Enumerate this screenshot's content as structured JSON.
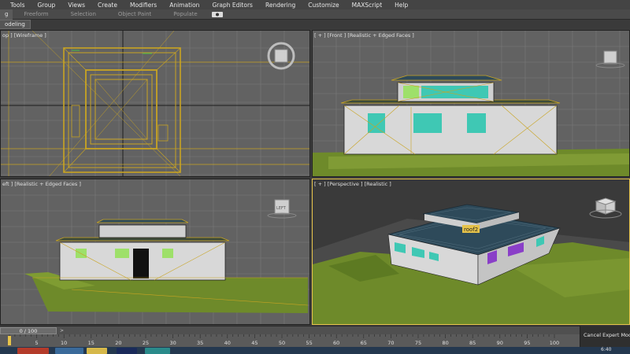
{
  "menu": {
    "items": [
      "Tools",
      "Group",
      "Views",
      "Create",
      "Modifiers",
      "Animation",
      "Graph Editors",
      "Rendering",
      "Customize",
      "MAXScript",
      "Help"
    ]
  },
  "ribbon": {
    "tabs": [
      "g",
      "Freeform",
      "Selection",
      "Object Paint",
      "Populate"
    ]
  },
  "subbar": {
    "tab_label": "odeling"
  },
  "viewports": {
    "top": {
      "label": "op ] [Wireframe ]",
      "cube_label": ""
    },
    "front": {
      "label": "[ + ] [Front ] [Realistic + Edged Faces ]",
      "cube_label": ""
    },
    "left": {
      "label": "eft ] [Realistic + Edged Faces ]",
      "cube_label": "LEFT"
    },
    "perspective": {
      "label": "[ + ] [Perspective ] [Realistic ]",
      "object_label": "roof2"
    }
  },
  "timeline": {
    "slider_text": "0 / 100",
    "ticks": [
      "5",
      "10",
      "15",
      "20",
      "25",
      "30",
      "35",
      "40",
      "45",
      "50",
      "55",
      "60",
      "65",
      "70",
      "75",
      "80",
      "85",
      "90",
      "95",
      "100"
    ]
  },
  "expert_mode": {
    "button_label": "Cancel Expert Mode"
  },
  "taskbar": {
    "clock": "6:40"
  },
  "colors": {
    "selection_yellow": "#e6c34a",
    "grass": "#6e8a2a",
    "wall": "#d8d8d8",
    "roof": "#2e4a5a",
    "window_cyan": "#3fc8b4",
    "window_purple": "#8a3fc8",
    "window_green": "#9ee06a"
  }
}
